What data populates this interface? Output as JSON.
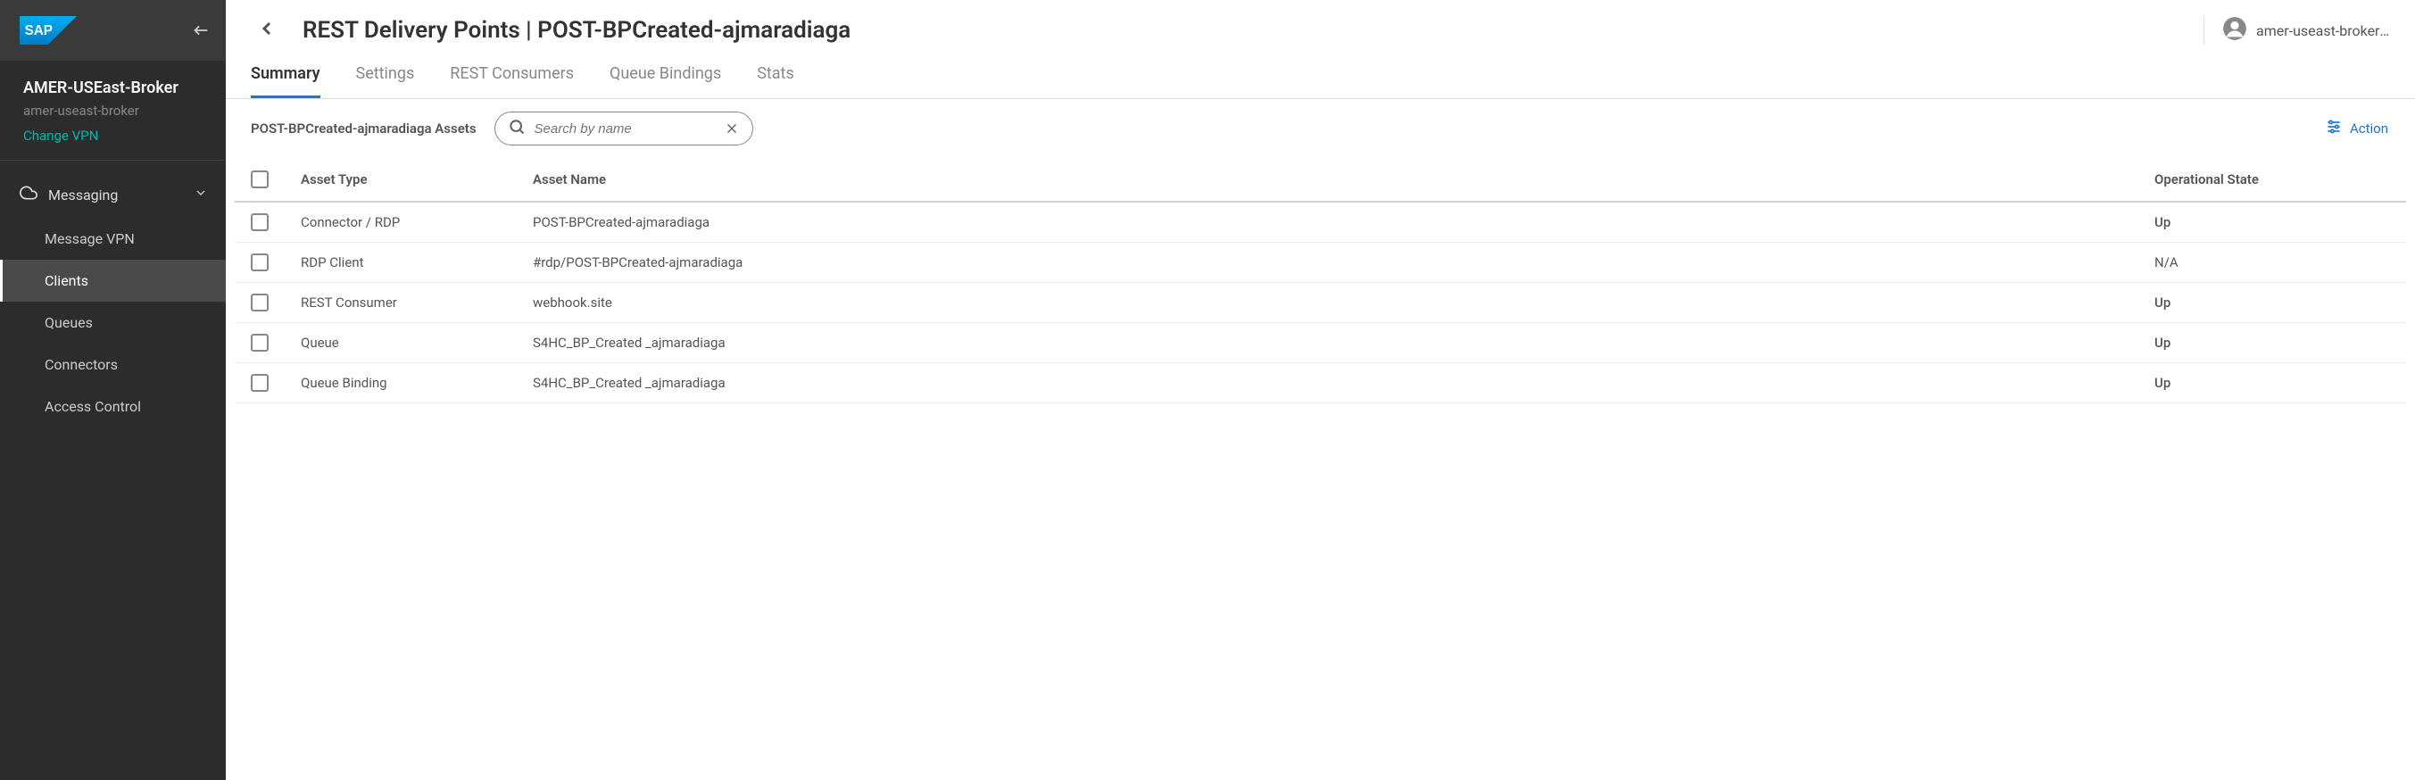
{
  "sidebar": {
    "broker_name": "AMER-USEast-Broker",
    "broker_sub": "amer-useast-broker",
    "change_vpn": "Change VPN",
    "group_label": "Messaging",
    "items": [
      {
        "label": "Message VPN"
      },
      {
        "label": "Clients"
      },
      {
        "label": "Queues"
      },
      {
        "label": "Connectors"
      },
      {
        "label": "Access Control"
      }
    ]
  },
  "header": {
    "title": "REST Delivery Points | POST-BPCreated-ajmaradiaga",
    "user": "amer-useast-broker-…"
  },
  "tabs": [
    {
      "label": "Summary"
    },
    {
      "label": "Settings"
    },
    {
      "label": "REST Consumers"
    },
    {
      "label": "Queue Bindings"
    },
    {
      "label": "Stats"
    }
  ],
  "toolbar": {
    "assets_label": "POST-BPCreated-ajmaradiaga Assets",
    "search_placeholder": "Search by name",
    "action_label": "Action"
  },
  "table": {
    "headers": {
      "type": "Asset Type",
      "name": "Asset Name",
      "state": "Operational State"
    },
    "rows": [
      {
        "type": "Connector / RDP",
        "name": "POST-BPCreated-ajmaradiaga",
        "state": "Up",
        "state_class": "state-up"
      },
      {
        "type": "RDP Client",
        "name": "#rdp/POST-BPCreated-ajmaradiaga",
        "state": "N/A",
        "state_class": "state-na"
      },
      {
        "type": "REST Consumer",
        "name": "webhook.site",
        "state": "Up",
        "state_class": "state-up"
      },
      {
        "type": "Queue",
        "name": "S4HC_BP_Created _ajmaradiaga",
        "state": "Up",
        "state_class": "state-up"
      },
      {
        "type": "Queue Binding",
        "name": "S4HC_BP_Created _ajmaradiaga",
        "state": "Up",
        "state_class": "state-up"
      }
    ]
  }
}
